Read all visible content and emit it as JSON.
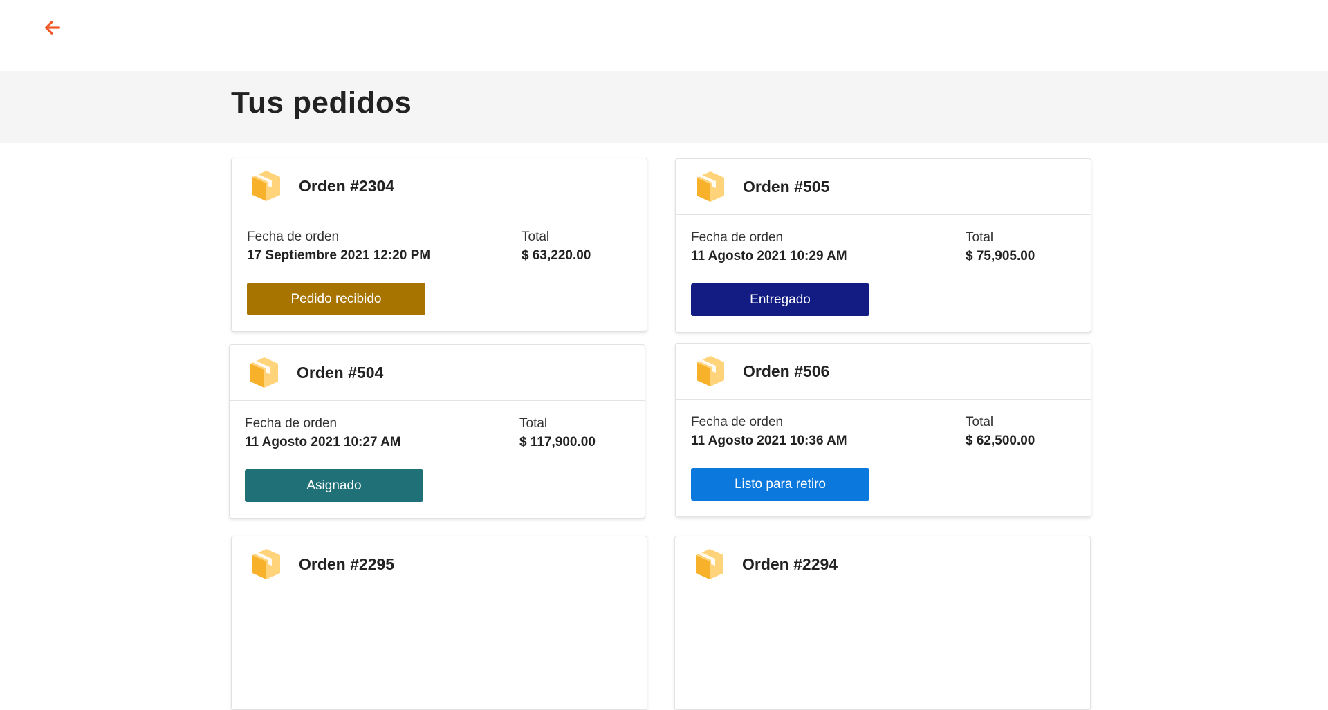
{
  "page": {
    "title": "Tus pedidos"
  },
  "labels": {
    "date": "Fecha de orden",
    "total": "Total"
  },
  "colors": {
    "back_arrow": "#f05a28",
    "box_main": "#f7b12a",
    "box_light": "#ffd37a"
  },
  "orders": [
    {
      "title": "Orden #2304",
      "date": "17 Septiembre 2021 12:20 PM",
      "total": "$ 63,220.00",
      "status": "Pedido recibido",
      "status_color": "#a77400"
    },
    {
      "title": "Orden #505",
      "date": "11 Agosto 2021 10:29 AM",
      "total": "$ 75,905.00",
      "status": "Entregado",
      "status_color": "#121c82"
    },
    {
      "title": "Orden #504",
      "date": "11 Agosto 2021 10:27 AM",
      "total": "$ 117,900.00",
      "status": "Asignado",
      "status_color": "#207177"
    },
    {
      "title": "Orden #506",
      "date": "11 Agosto 2021 10:36 AM",
      "total": "$ 62,500.00",
      "status": "Listo para retiro",
      "status_color": "#0b78de"
    },
    {
      "title": "Orden #2295"
    },
    {
      "title": "Orden #2294"
    }
  ]
}
